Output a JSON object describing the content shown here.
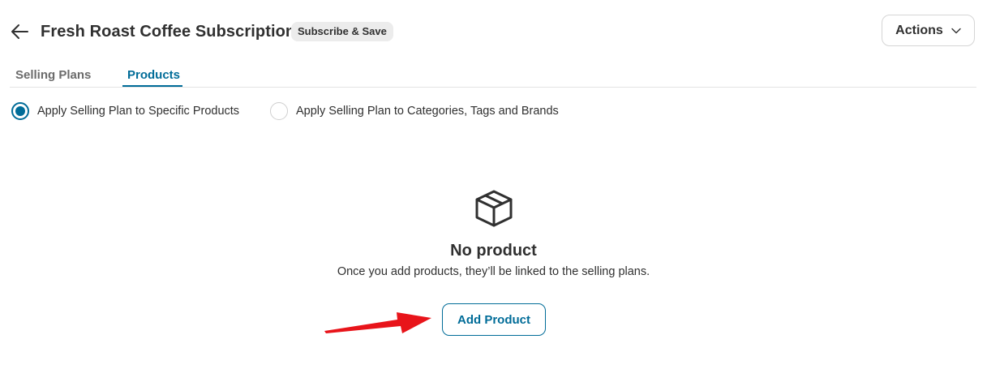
{
  "header": {
    "title": "Fresh Roast Coffee Subscription",
    "badge": "Subscribe & Save",
    "actions_label": "Actions",
    "back_icon": "arrow-left-icon",
    "actions_icon": "chevron-down-icon"
  },
  "tabs": [
    {
      "label": "Selling Plans",
      "selected": false
    },
    {
      "label": "Products",
      "selected": true
    }
  ],
  "scope_options": [
    {
      "label": "Apply Selling Plan to Specific Products",
      "checked": true
    },
    {
      "label": "Apply Selling Plan to Categories, Tags and Brands",
      "checked": false
    }
  ],
  "empty_state": {
    "icon": "package-box-icon",
    "title": "No product",
    "description": "Once you add products, they’ll be linked to the selling plans.",
    "button_label": "Add Product"
  },
  "annotation": {
    "type": "red-arrow",
    "points_to": "Add Product",
    "color": "#e8141a"
  },
  "colors": {
    "accent": "#006c98",
    "text": "#303030",
    "muted_tab": "#6b6b6b",
    "badge_bg": "#ececec",
    "divider": "#e3e3e3"
  }
}
